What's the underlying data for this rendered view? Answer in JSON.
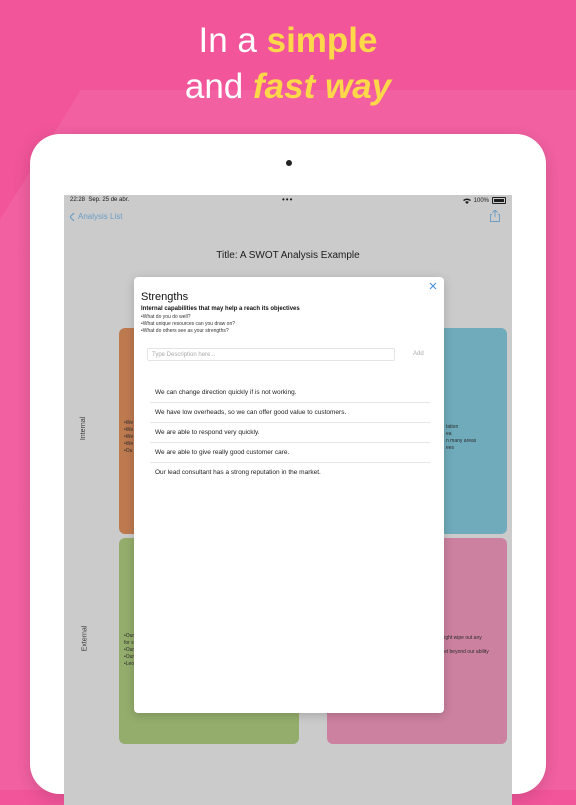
{
  "headline": {
    "line1_prefix": "In a ",
    "line1_accent": "simple",
    "line2_prefix": "and ",
    "line2_accent": "fast way"
  },
  "colors": {
    "background": "#f2559a",
    "accent_text": "#ffd84a",
    "quadrant_strengths": "#d98b5b",
    "quadrant_weaknesses": "#7fc3d4",
    "quadrant_opportunities": "#a9c57b",
    "quadrant_threats": "#e893b6",
    "link_blue": "#4a90d9"
  },
  "statusbar": {
    "time": "22:28",
    "date": "Sep. 25 de abr.",
    "dots": "•••",
    "battery": "100%"
  },
  "navbar": {
    "back_label": "Analysis List",
    "back_icon": "chevron-left-icon",
    "share_icon": "share-icon"
  },
  "document": {
    "title": "Title: A SWOT Analysis Example"
  },
  "axis_labels": {
    "internal": "Internal",
    "external": "External"
  },
  "background_quadrants": {
    "top_left": [
      "•We",
      "•We",
      "•We",
      "•We",
      "•Ou"
    ],
    "top_right": [
      "tation",
      "ea",
      "n many areas",
      "ees"
    ],
    "bottom_left": [
      "•Our",
      "for s",
      "•Our",
      "•Our",
      "•Leo"
    ],
    "bottom_right": [
      "r might wipe out any",
      "",
      "arket beyond our ability"
    ]
  },
  "modal": {
    "heading": "Strengths",
    "close_icon": "close-icon",
    "subheading": "Internal capabilities that may help a reach its objectives",
    "questions": [
      "•What do you do well?",
      "•What unique resources can you draw on?",
      "•What do others see as your strengths?"
    ],
    "input_placeholder": "Type Description here...",
    "add_label": "Add",
    "items": [
      "We can change direction quickly if is not working.",
      "We have low overheads, so we can offer good value to customers.",
      "We are able to respond very quickly.",
      "We are able to give really good customer care.",
      "Our lead consultant has a strong reputation in the market."
    ]
  }
}
